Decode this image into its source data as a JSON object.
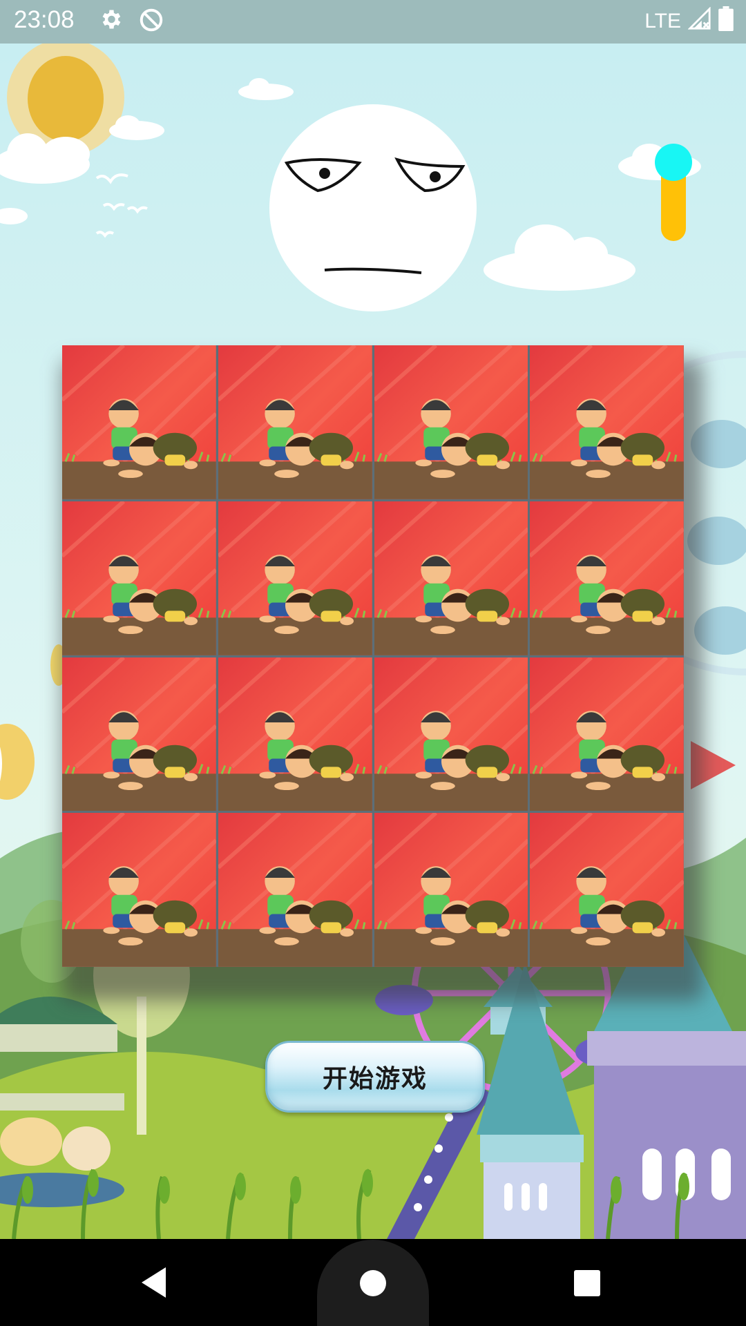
{
  "status_bar": {
    "time": "23:08",
    "icons": [
      "gear-icon",
      "no-disturb-icon"
    ],
    "network": "LTE",
    "right_icons": [
      "signal-icon",
      "battery-icon"
    ]
  },
  "game": {
    "face": "unamused-moon-face",
    "toggle": {
      "state": "on",
      "knob_color": "#18f6f4",
      "track_color": "#ffc107"
    },
    "board": {
      "rows": 4,
      "cols": 4,
      "tile_picture": "two-cartoon-kids-red-background"
    },
    "start_button_label": "开始游戏"
  },
  "nav_bar": {
    "buttons": [
      "back-button",
      "home-button",
      "recents-button"
    ]
  }
}
